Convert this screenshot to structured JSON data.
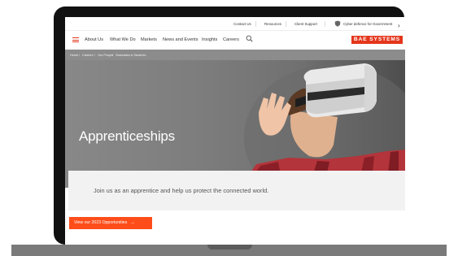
{
  "utility_nav": {
    "items": [
      "Contact Us",
      "Resources",
      "Client Support"
    ],
    "promo_label": "Cyber defence for Government"
  },
  "main_nav": {
    "items": [
      "About Us",
      "What We Do",
      "Markets",
      "News and Events",
      "Insights",
      "Careers"
    ],
    "logo_text": "BAE SYSTEMS"
  },
  "breadcrumb": {
    "items": [
      "Home",
      "Careers",
      "Our People",
      "Graduates & Students"
    ],
    "separator": "/"
  },
  "hero": {
    "title": "Apprenticeships"
  },
  "intro": {
    "text": "Join us as an apprentice and help us protect the connected world."
  },
  "cta": {
    "label": "View our 2023 Opportunities",
    "arrow": "→"
  },
  "icons": {
    "menu": "menu-icon",
    "search": "search-icon",
    "shield": "shield-icon",
    "chevron": "chevron-right-icon"
  },
  "colors": {
    "brand_red": "#e4361b",
    "cta_orange": "#ff4d1a",
    "hero_gray": "#7d7d7d",
    "laptop_frame": "#111111"
  }
}
